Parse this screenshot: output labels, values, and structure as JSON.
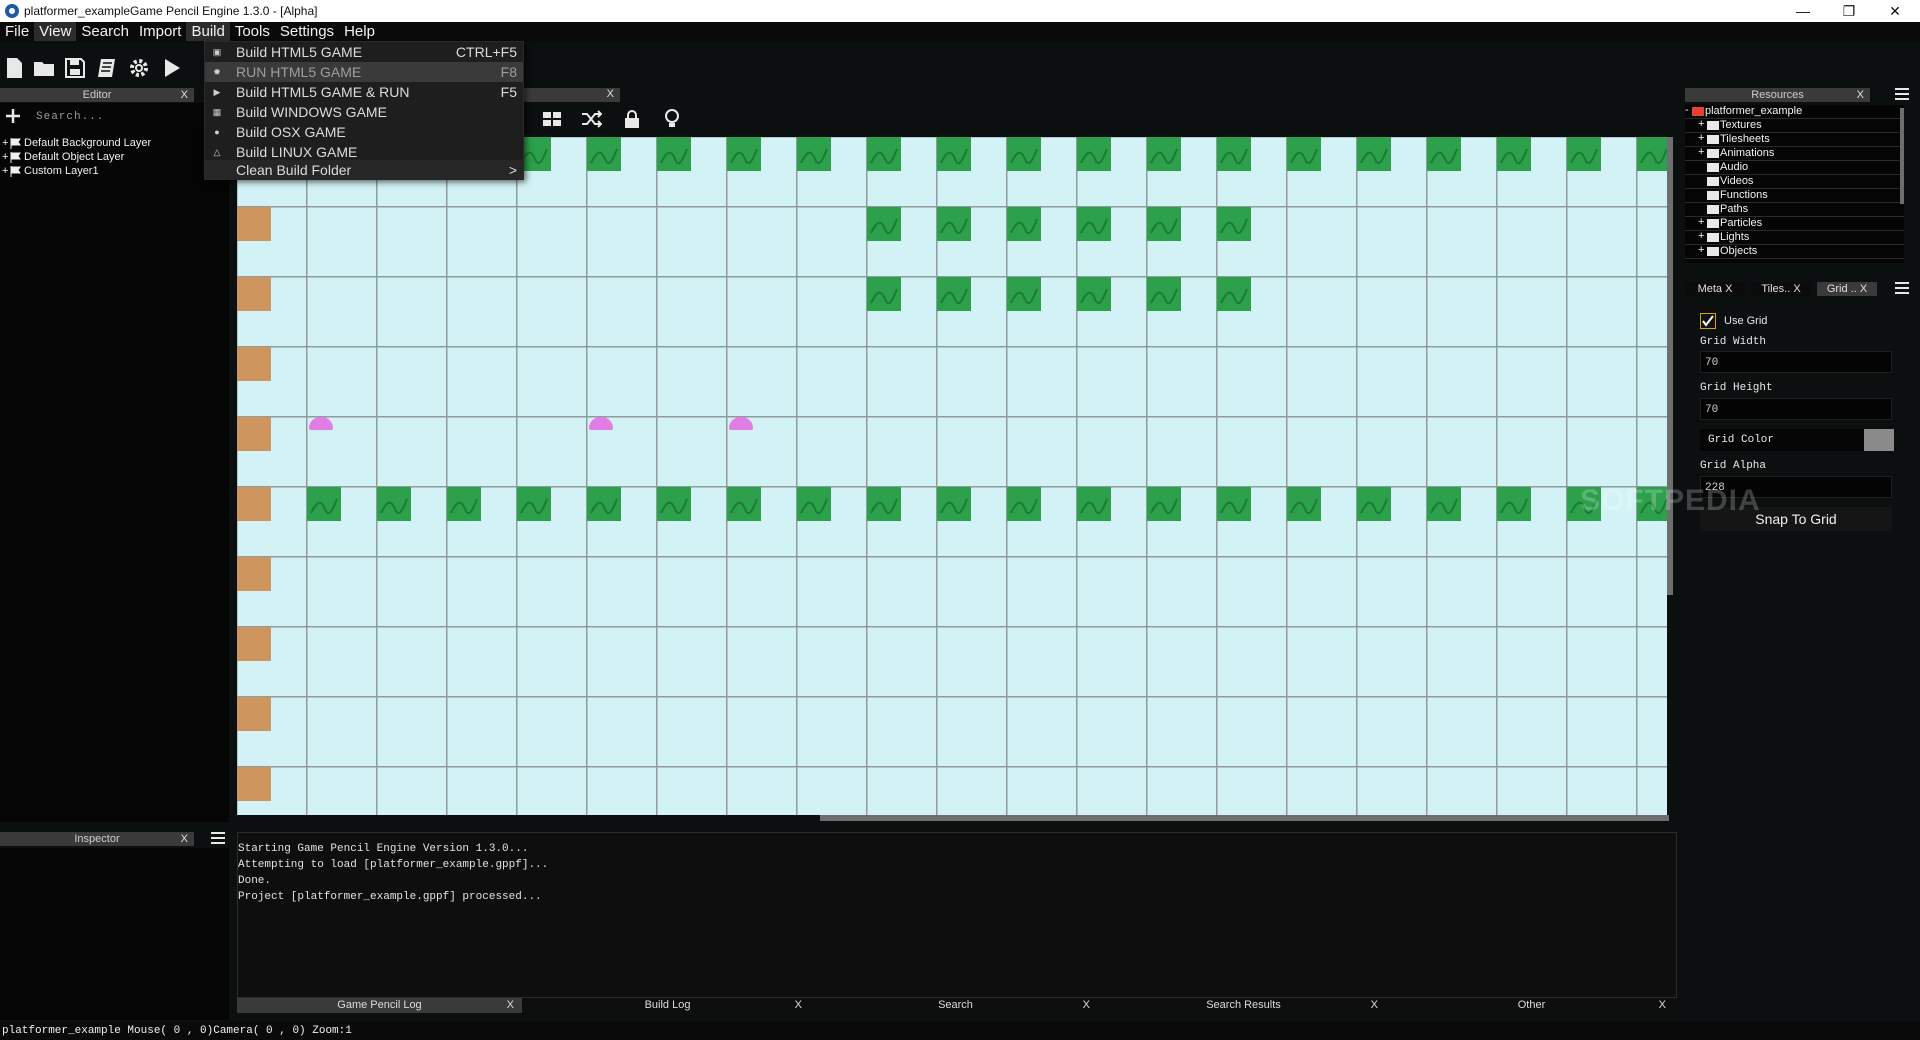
{
  "window": {
    "title": "platformer_exampleGame Pencil Engine  1.3.0 - [Alpha]"
  },
  "menubar": [
    "File",
    "View",
    "Search",
    "Import",
    "Build",
    "Tools",
    "Settings",
    "Help"
  ],
  "build_menu": {
    "items": [
      {
        "label": "Build HTML5 GAME",
        "shortcut": "CTRL+F5"
      },
      {
        "label": "RUN HTML5 GAME",
        "shortcut": "F8"
      },
      {
        "label": "Build HTML5 GAME & RUN",
        "shortcut": "F5"
      },
      {
        "label": "Build WINDOWS GAME",
        "shortcut": ""
      },
      {
        "label": "Build OSX GAME",
        "shortcut": ""
      },
      {
        "label": "Build LINUX GAME",
        "shortcut": ""
      },
      {
        "label": "Clean Build Folder",
        "shortcut": ">"
      }
    ]
  },
  "editor": {
    "title": "Editor",
    "close": "X",
    "search_placeholder": "Search...",
    "layers": [
      "Default Background Layer",
      "Default Object Layer",
      "Custom Layer1"
    ]
  },
  "inspector": {
    "title": "Inspector",
    "close": "X"
  },
  "resources": {
    "title": "Resources",
    "close": "X",
    "project": "platformer_example",
    "items": [
      {
        "name": "Textures",
        "expand": "+"
      },
      {
        "name": "Tilesheets",
        "expand": "+"
      },
      {
        "name": "Animations",
        "expand": "+"
      },
      {
        "name": "Audio",
        "expand": ""
      },
      {
        "name": "Videos",
        "expand": ""
      },
      {
        "name": "Functions",
        "expand": ""
      },
      {
        "name": "Paths",
        "expand": ""
      },
      {
        "name": "Particles",
        "expand": "+"
      },
      {
        "name": "Lights",
        "expand": "+"
      },
      {
        "name": "Objects",
        "expand": "+"
      }
    ]
  },
  "grid_panel": {
    "tabs": [
      "Meta X",
      "Tiles.. X",
      "Grid .. X"
    ],
    "use_grid_label": "Use Grid",
    "use_grid_checked": true,
    "grid_width_label": "Grid Width",
    "grid_width": "70",
    "grid_height_label": "Grid Height",
    "grid_height": "70",
    "grid_color_label": "Grid Color",
    "grid_color": "#8a8a8a",
    "grid_alpha_label": "Grid Alpha",
    "grid_alpha": "228",
    "snap_label": "Snap To Grid"
  },
  "console": {
    "lines": [
      "Starting Game Pencil Engine Version 1.3.0...",
      "Attempting to load [platformer_example.gppf]...",
      "Done.",
      "Project [platformer_example.gppf] processed..."
    ],
    "tabs": [
      "Game Pencil Log",
      "Build Log",
      "Search",
      "Search Results",
      "Other"
    ],
    "tab_close": "X"
  },
  "scene_tab_close": "X",
  "statusbar": "platformer_example Mouse( 0 , 0)Camera( 0 , 0) Zoom:1",
  "watermark": "SOFTPEDIA",
  "colors": {
    "sky": "#d2f2f5",
    "grass": "#2ca04b",
    "dirt": "#cf955e",
    "slime": "#e07ee6",
    "accent_project": "#e8412f"
  }
}
